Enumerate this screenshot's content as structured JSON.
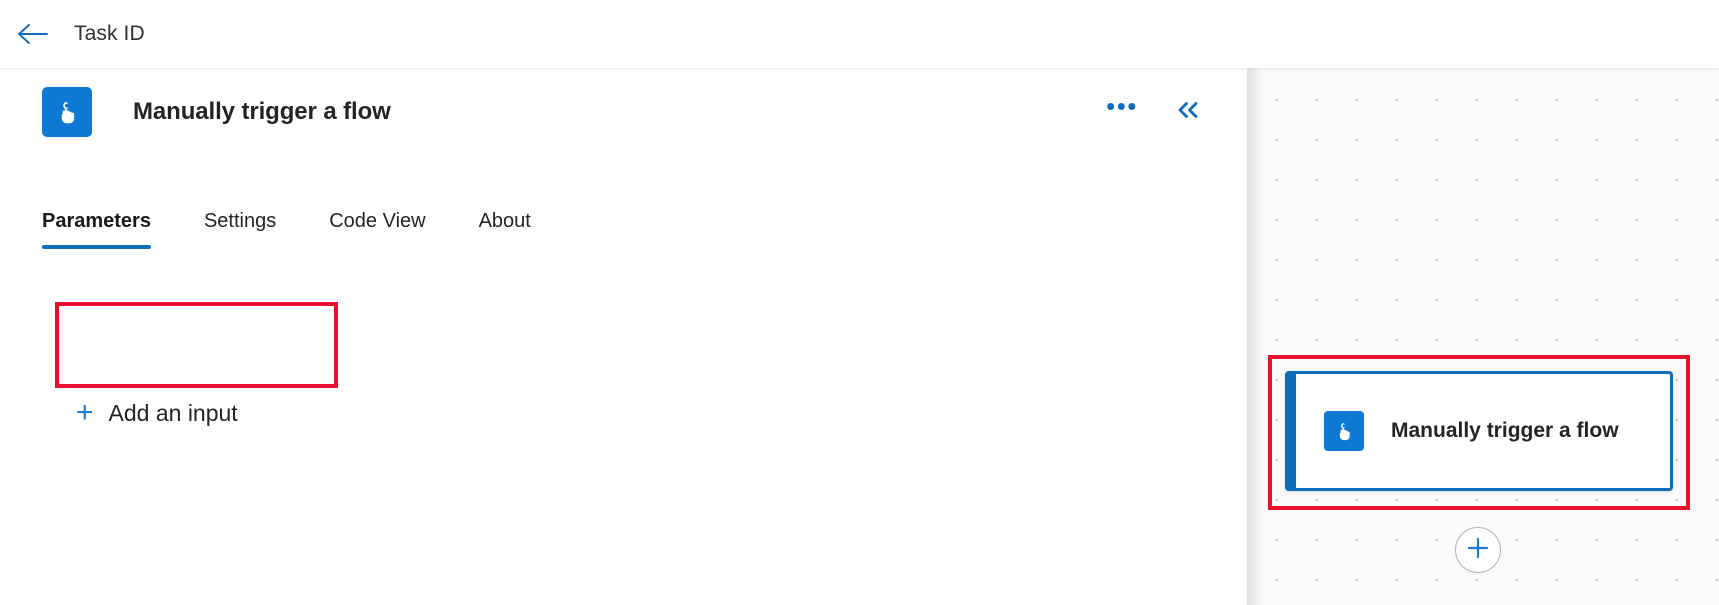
{
  "top_bar": {
    "back_icon": "arrow-left-icon",
    "title": "Task ID"
  },
  "details_panel": {
    "icon": "manual-trigger-tap-icon",
    "title": "Manually trigger a flow",
    "more_options_label": "•••",
    "more_options_icon": "ellipsis-icon",
    "collapse_icon": "double-chevron-left-icon",
    "tabs": [
      {
        "label": "Parameters",
        "active": true
      },
      {
        "label": "Settings",
        "active": false
      },
      {
        "label": "Code View",
        "active": false
      },
      {
        "label": "About",
        "active": false
      }
    ],
    "add_input": {
      "plus_glyph": "+",
      "label": "Add an input"
    }
  },
  "canvas": {
    "node": {
      "icon": "manual-trigger-tap-icon",
      "title": "Manually trigger a flow"
    },
    "add_step": {
      "icon": "plus-icon"
    }
  },
  "colors": {
    "accent_blue": "#0f6cbd",
    "icon_blue": "#0f78d4",
    "highlight_red": "#e8112d",
    "text_primary": "#242424",
    "canvas_bg": "#fafafa"
  }
}
